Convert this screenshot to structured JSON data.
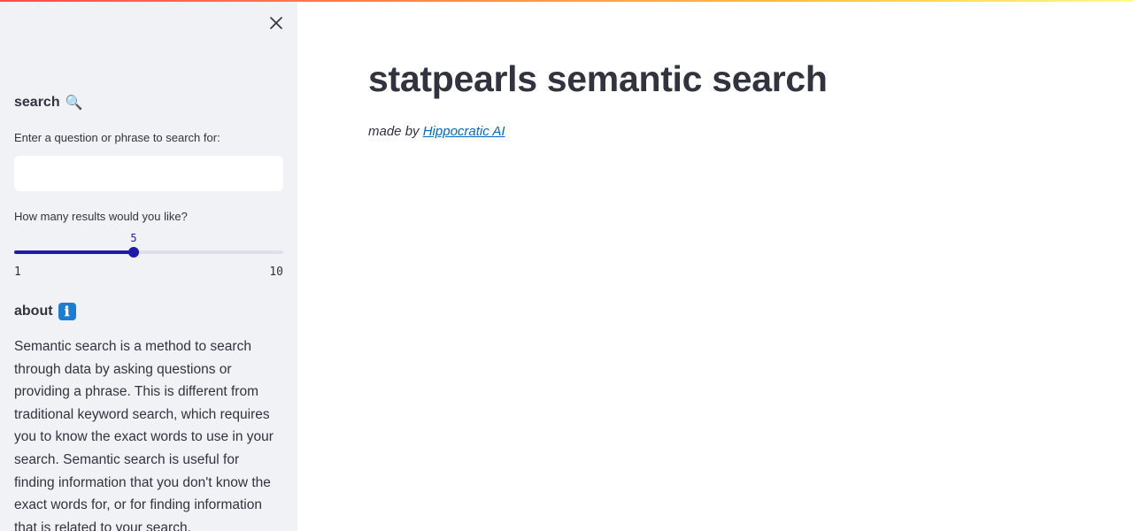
{
  "sidebar": {
    "search_heading": "search",
    "search_heading_icon": "🔍",
    "query_label": "Enter a question or phrase to search for:",
    "query_value": "",
    "query_placeholder": "",
    "results_label": "How many results would you like?",
    "results_slider": {
      "value": "5",
      "min": "1",
      "max": "10"
    },
    "about_heading": "about",
    "about_heading_icon": "ℹ",
    "about_text": "Semantic search is a method to search through data by asking questions or providing a phrase. This is different from traditional keyword search, which requires you to know the exact words to use in your search. Semantic search is useful for finding information that you don't know the exact words for, or for finding information that is related to your search."
  },
  "main": {
    "title": "statpearls semantic search",
    "byline_prefix": "made by",
    "byline_link": "Hippocratic AI"
  },
  "colors": {
    "slider_accent": "#1c1ca8",
    "link": "#0068c9",
    "sidebar_bg": "#f0f2f6",
    "text": "#31333f"
  },
  "icons": [
    "close-icon",
    "magnifying-glass-icon",
    "info-icon"
  ]
}
